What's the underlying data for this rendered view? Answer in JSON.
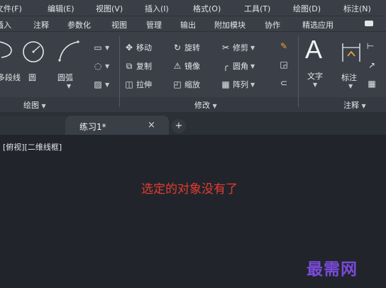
{
  "menu": [
    "文件(F)",
    "编辑(E)",
    "视图(V)",
    "插入(I)",
    "格式(O)",
    "工具(T)",
    "绘图(D)",
    "标注(N)"
  ],
  "ribbon_tabs": [
    "插入",
    "注释",
    "参数化",
    "视图",
    "管理",
    "输出",
    "附加模块",
    "协作",
    "精选应用"
  ],
  "ribbon": {
    "draw": {
      "title": "绘图",
      "big_tools": [
        "多段线",
        "圆",
        "圆弧"
      ],
      "small_icons": [
        "rectangle-icon",
        "ellipse-icon",
        "hatch-icon"
      ]
    },
    "modify": {
      "title": "修改",
      "tools": [
        {
          "label": "移动",
          "icon": "move-icon"
        },
        {
          "label": "旋转",
          "icon": "rotate-icon"
        },
        {
          "label": "修剪",
          "icon": "trim-icon"
        },
        {
          "label": "复制",
          "icon": "copy-icon"
        },
        {
          "label": "镜像",
          "icon": "mirror-icon"
        },
        {
          "label": "圆角",
          "icon": "fillet-icon"
        },
        {
          "label": "拉伸",
          "icon": "stretch-icon"
        },
        {
          "label": "缩放",
          "icon": "scale-icon"
        },
        {
          "label": "阵列",
          "icon": "array-icon"
        }
      ]
    },
    "annotate": {
      "title": "注释",
      "big_tools": [
        "文字",
        "标注"
      ]
    }
  },
  "document_tab": {
    "label": "练习1*",
    "close": "×",
    "add": "+"
  },
  "viewport_label": "[俯视][二维线框]",
  "message": "选定的对象没有了",
  "watermark": "最需网",
  "colors": {
    "message": "#e53b31",
    "watermark": "#7a4ad8",
    "background": "#21252b",
    "ribbon": "#3b4048"
  }
}
